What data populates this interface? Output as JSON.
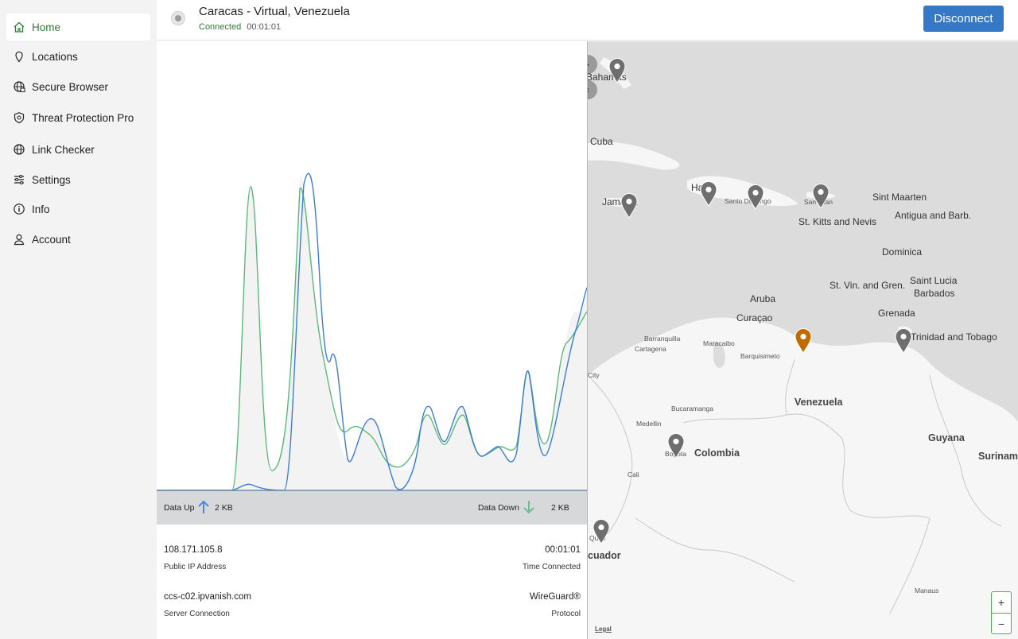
{
  "sidebar": {
    "items": [
      {
        "label": "Home",
        "icon": "home-icon",
        "active": true
      },
      {
        "label": "Locations",
        "icon": "pin-icon"
      },
      {
        "label": "Secure Browser",
        "icon": "globe-lock-icon"
      },
      {
        "label": "Threat Protection Pro",
        "icon": "shield-icon"
      },
      {
        "label": "Link Checker",
        "icon": "globe-check-icon"
      },
      {
        "label": "Settings",
        "icon": "sliders-icon"
      },
      {
        "label": "Info",
        "icon": "info-icon"
      },
      {
        "label": "Account",
        "icon": "user-icon"
      }
    ]
  },
  "header": {
    "location": "Caracas - Virtual, Venezuela",
    "status": "Connected",
    "elapsed": "00:01:01",
    "disconnect_label": "Disconnect"
  },
  "traffic": {
    "up_label": "Data Up",
    "up_value": "2 KB",
    "down_label": "Data Down",
    "down_value": "2 KB"
  },
  "connection": {
    "ip": "108.171.105.8",
    "ip_label": "Public IP Address",
    "time": "00:01:01",
    "time_label": "Time Connected",
    "server": "ccs-c02.ipvanish.com",
    "server_label": "Server Connection",
    "protocol": "WireGuard®",
    "protocol_label": "Protocol"
  },
  "map": {
    "labels": {
      "bahamas": "Bahamas",
      "cuba": "Cuba",
      "jamaica": "Jamaica",
      "haiti": "Haiti",
      "santo_domingo": "Santo Domingo",
      "san_juan": "San Juan",
      "sint_maarten": "Sint Maarten",
      "st_kitts": "St. Kitts and Nevis",
      "antigua": "Antigua and Barb.",
      "dominica": "Dominica",
      "st_vin": "St. Vin. and Gren.",
      "saint_lucia": "Saint Lucia",
      "barbados": "Barbados",
      "aruba": "Aruba",
      "curacao": "Curaçao",
      "grenada": "Grenada",
      "trinidad": "Trinidad and Tobago",
      "barranquilla": "Barranquilla",
      "cartagena": "Cartagena",
      "maracaibo": "Maracaibo",
      "barquisimeto": "Barquisimeto",
      "panama_city": "City",
      "venezuela": "Venezuela",
      "bucaramanga": "Bucaramanga",
      "medellin": "Medellin",
      "bogota": "Bogota",
      "colombia": "Colombia",
      "guyana": "Guyana",
      "suriname": "Suriname",
      "cali": "Cali",
      "quito": "Quito",
      "ecuador": "cuador",
      "manaus": "Manaus",
      "legal": "Legal"
    },
    "zoom_in": "+",
    "zoom_out": "−",
    "collapse_right": "›",
    "collapse_left": "‹"
  },
  "colors": {
    "accent_green": "#2e7d32",
    "disconnect_blue": "#3478c6",
    "pin_active": "#c06a00",
    "pin_default": "#6e6e6e",
    "line_up": "#3b7dd8",
    "line_down": "#5cb87a"
  }
}
